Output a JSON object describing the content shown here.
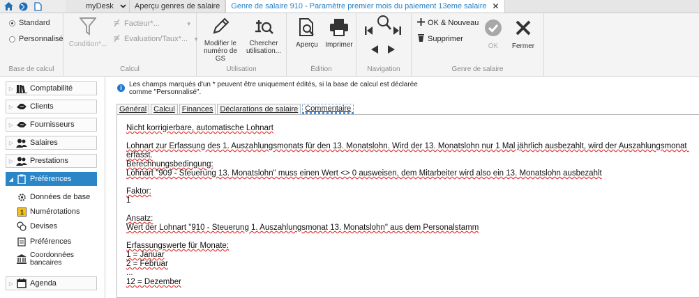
{
  "topbar": {
    "icons": [
      "home-icon",
      "globe-icon",
      "document-icon"
    ],
    "tabs": [
      {
        "label": "myDesk"
      },
      {
        "label": "Aperçu genres de salaire"
      },
      {
        "label": "Genre de salaire 910 - Paramètre premier mois du paiement 13eme salaire"
      }
    ],
    "close_symbol": "✕"
  },
  "ribbon": {
    "base_calcul": {
      "options": [
        {
          "label": "Standard",
          "selected": true
        },
        {
          "label": "Personnalisé",
          "selected": false
        }
      ],
      "group_label": "Base de calcul"
    },
    "calcul": {
      "condition_label": "Condition*...",
      "facteur_label": "Facteur*...",
      "evaluation_label": "Evaluation/Taux*...",
      "group_label": "Calcul"
    },
    "utilisation": {
      "modifier_label": "Modifier le numéro de GS",
      "chercher_label": "Chercher utilisation...",
      "group_label": "Utilisation"
    },
    "edition": {
      "apercu_label": "Aperçu",
      "imprimer_label": "Imprimer",
      "group_label": "Édition"
    },
    "navigation": {
      "group_label": "Navigation"
    },
    "genre": {
      "ok_nouveau_label": "OK & Nouveau",
      "supprimer_label": "Supprimer",
      "ok_label": "OK",
      "fermer_label": "Fermer",
      "group_label": "Genre de salaire"
    }
  },
  "sidebar": {
    "items": [
      {
        "label": "Comptabilité",
        "icon": "books-icon"
      },
      {
        "label": "Clients",
        "icon": "handshake-icon"
      },
      {
        "label": "Fournisseurs",
        "icon": "handshake-icon"
      },
      {
        "label": "Salaires",
        "icon": "people-icon"
      },
      {
        "label": "Prestations",
        "icon": "people-icon"
      },
      {
        "label": "Préférences",
        "icon": "clipboard-icon",
        "selected": true
      },
      {
        "label": "Agenda",
        "icon": "calendar-icon"
      }
    ],
    "subitems": [
      {
        "label": "Données de base",
        "icon": "gear-icon"
      },
      {
        "label": "Numérotations",
        "icon": "numbering-icon"
      },
      {
        "label": "Devises",
        "icon": "coins-icon"
      },
      {
        "label": "Préférences",
        "icon": "checklist-icon"
      },
      {
        "label": "Coordonnées bancaires",
        "icon": "bank-icon"
      }
    ]
  },
  "main": {
    "info_line1": "Les champs marqués d'un * peuvent être uniquement édités, si la base de calcul est déclarée",
    "info_line2": "comme \"Personnalisé\".",
    "tabs": [
      "Général",
      "Calcul",
      "Finances",
      "Déclarations de salaire",
      "Commentaire"
    ],
    "active_tab": "Commentaire",
    "comment_lines": [
      "Nicht korrigierbare, automatische Lohnart",
      "",
      "Lohnart zur Erfassung des 1. Auszahlungsmonats für den 13. Monatslohn. Wird der 13. Monatslohn nur 1 Mal jährlich ausbezahlt, wird der Auszahlungsmonat erfasst.",
      "",
      "Berechnungsbedingung:",
      "Lohnart \"909 - Steuerung 13. Monatslohn\" muss einen Wert <> 0 ausweisen, dem Mitarbeiter wird also ein 13. Monatslohn ausbezahlt",
      "",
      "Faktor:",
      "1",
      "",
      "Ansatz:",
      "Wert der Lohnart \"910 - Steuerung 1. Auszahlungsmonat 13. Monatslohn\" aus dem Personalstamm",
      "",
      "Erfassungswerte für Monate:",
      "1 = Januar",
      "2 = Februar",
      "...",
      "12 = Dezember"
    ]
  },
  "colors": {
    "accent": "#2b86c8",
    "active_tab_text": "#2a7fc1",
    "info": "#1e78c8"
  }
}
